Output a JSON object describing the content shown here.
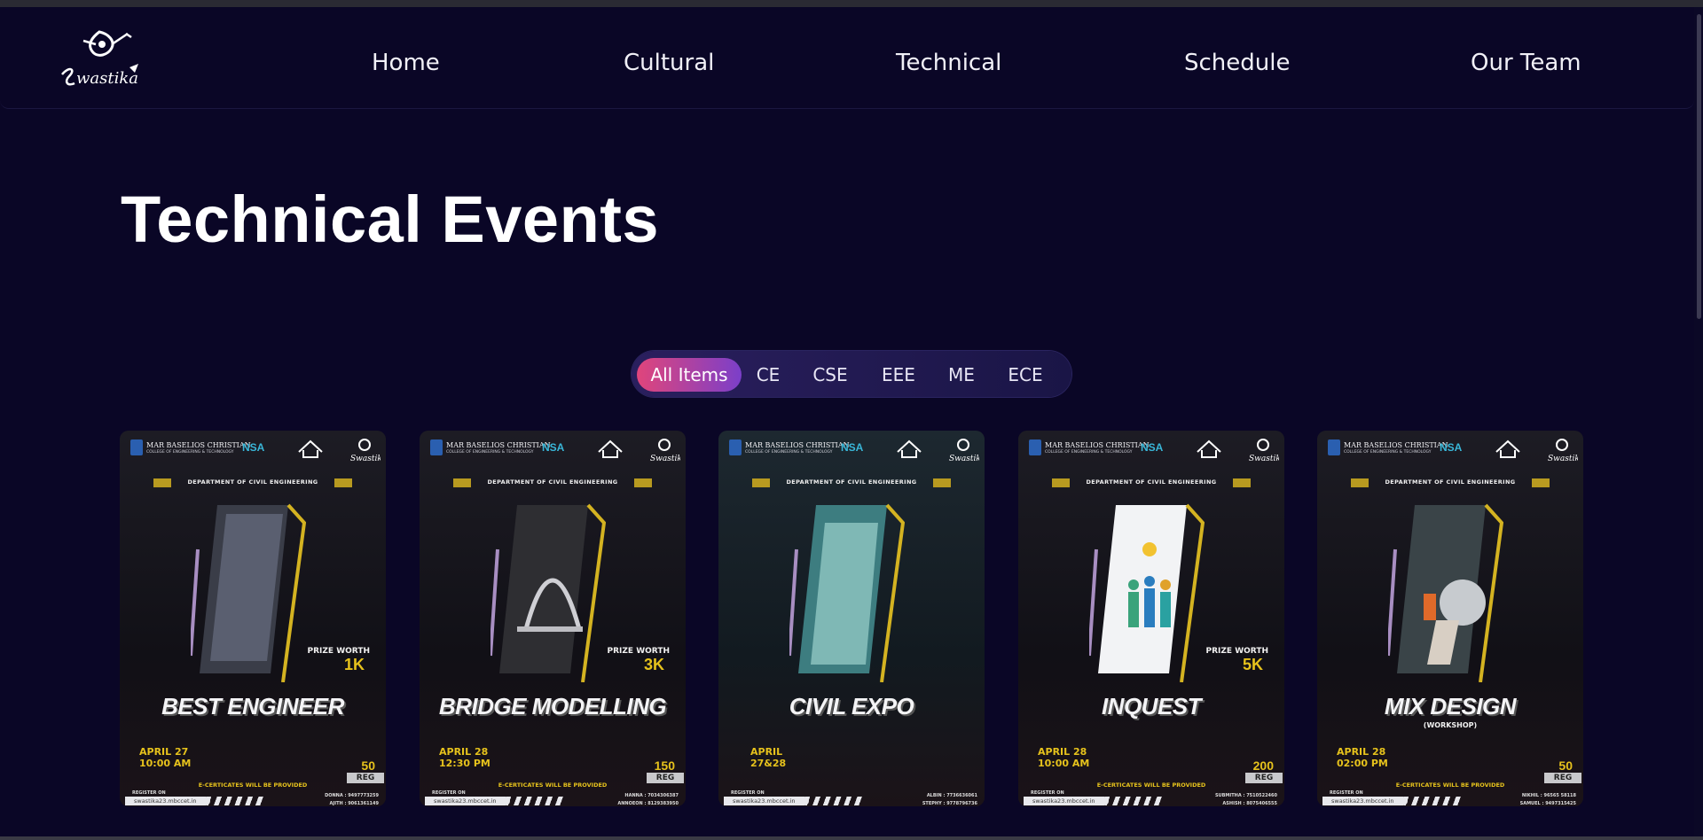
{
  "nav": {
    "logo_alt": "Swastika",
    "items": [
      "Home",
      "Cultural",
      "Technical",
      "Schedule",
      "Our Team"
    ]
  },
  "page": {
    "title": "Technical Events"
  },
  "filters": {
    "items": [
      "All Items",
      "CE",
      "CSE",
      "EEE",
      "ME",
      "ECE"
    ],
    "active": "All Items"
  },
  "poster_common": {
    "institution": "MAR BASELIOS CHRISTIAN",
    "institution_sub": "COLLEGE OF ENGINEERING & TECHNOLOGY",
    "nsa": "NSA",
    "department": "DEPARTMENT OF CIVIL ENGINEERING",
    "certificate": "E-CERTICATES WILL BE PROVIDED",
    "register_on": "REGISTER ON",
    "url": "swastika23.mbccet.in",
    "reg_label": "REG",
    "prize_label": "PRIZE WORTH"
  },
  "cards": [
    {
      "title": "BEST  ENGINEER",
      "subtitle": "",
      "prize": "1K",
      "date": "APRIL 27\n10:00 AM",
      "reg_fee": "50",
      "contacts": "DONNA : 9497773259\nAJITH : 9061361149"
    },
    {
      "title": "BRIDGE MODELLING",
      "subtitle": "",
      "prize": "3K",
      "date": "APRIL 28\n12:30 PM",
      "reg_fee": "150",
      "contacts": "HANNA : 7034306387\nANNOEON : 8129383950"
    },
    {
      "title": "CIVIL EXPO",
      "subtitle": "",
      "prize": "",
      "date": "APRIL\n27&28",
      "reg_fee": "",
      "contacts": "ALBIN : 7736636061\nSTEPHY : 9778796736"
    },
    {
      "title": "INQUEST",
      "subtitle": "",
      "prize": "5K",
      "date": "APRIL 28\n10:00 AM",
      "reg_fee": "200",
      "contacts": "SUBMITHA : 7510522460\nASHISH : 8075406555"
    },
    {
      "title": "MIX DESIGN",
      "subtitle": "(WORKSHOP)",
      "prize": "",
      "date": "APRIL 28\n02:00 PM",
      "reg_fee": "50",
      "contacts": "NIKHIL : 96565 58118\nSAMUEL : 9497315425"
    }
  ],
  "colors": {
    "background": "#0a0626",
    "accent_yellow": "#e6c21c",
    "filter_active_start": "#e0457b",
    "filter_active_end": "#7b3fc9"
  }
}
